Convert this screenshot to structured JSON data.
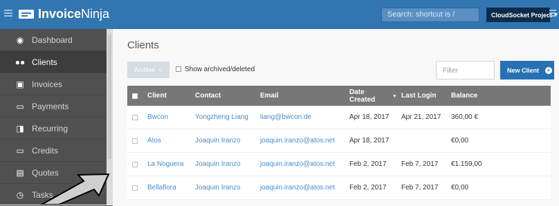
{
  "brand": {
    "name_bold": "Invoice",
    "name_light": "Ninja"
  },
  "search": {
    "placeholder": "Search: shortcut is /"
  },
  "project": {
    "label": "CloudSocket Project",
    "caret": "▾"
  },
  "sidebar": {
    "items": [
      {
        "label": "Dashboard",
        "icon": "dashboard-icon",
        "active": false
      },
      {
        "label": "Clients",
        "icon": "users-icon",
        "active": true
      },
      {
        "label": "Invoices",
        "icon": "document-icon",
        "active": false
      },
      {
        "label": "Payments",
        "icon": "card-icon",
        "active": false
      },
      {
        "label": "Recurring",
        "icon": "recurring-icon",
        "active": false
      },
      {
        "label": "Credits",
        "icon": "card-icon",
        "active": false
      },
      {
        "label": "Quotes",
        "icon": "quote-icon",
        "active": false
      },
      {
        "label": "Tasks",
        "icon": "clock-icon",
        "active": false
      }
    ]
  },
  "main": {
    "title": "Clients",
    "archive_label": "Archive",
    "show_archived_label": "Show archived/deleted",
    "filter_placeholder": "Filter",
    "new_client_label": "New Client",
    "new_client_plus": "+"
  },
  "table": {
    "headers": [
      "Client",
      "Contact",
      "Email",
      "Date Created",
      "Last Login",
      "Balance"
    ],
    "sort_caret": "▾",
    "rows": [
      {
        "client": "Bwcon",
        "contact": "Yongzheng Liang",
        "email": "liang@bwcon.de",
        "created": "Apr 18, 2017",
        "login": "Apr 21, 2017",
        "balance": "360,00 €"
      },
      {
        "client": "Atos",
        "contact": "Joaquin Iranzo",
        "email": "joaquin.iranzo@atos.net",
        "created": "Apr 18, 2017",
        "login": "",
        "balance": "€0,00"
      },
      {
        "client": "La Noguera",
        "contact": "Joaquin Iranzo",
        "email": "joaquin.iranzo@atos.net",
        "created": "Feb 2, 2017",
        "login": "Feb 7, 2017",
        "balance": "€1.159,00"
      },
      {
        "client": "Bellaflora",
        "contact": "Joaquin Iranzo",
        "email": "joaquin.iranzo@atos.net",
        "created": "Feb 2, 2017",
        "login": "Feb 7, 2017",
        "balance": "€0,00"
      }
    ]
  },
  "colors": {
    "topbar": "#3276b1",
    "sidebar": "#505050",
    "accent": "#2671b5",
    "header": "#777777",
    "link": "#4a8cc7"
  }
}
